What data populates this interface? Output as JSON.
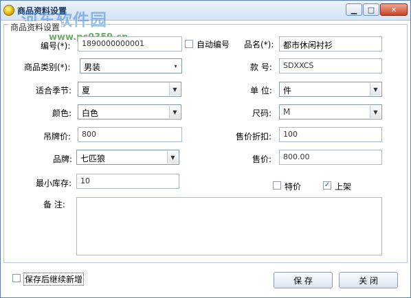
{
  "window": {
    "title": "商品资料设置",
    "watermark": "河东软件园",
    "watermark_url": "www.pc0359.cn",
    "controls": [
      "minimize-icon",
      "maximize-icon",
      "close-icon"
    ]
  },
  "group_title": "商品资料设置",
  "form": {
    "code_label": "编号(*):",
    "code_value": "1890000000001",
    "auto_code_label": "自动编号",
    "auto_code_checked": false,
    "name_label": "品名(*):",
    "name_value": "都市休闲衬衫",
    "category_label": "商品类别(*):",
    "category_value": "男装",
    "style_label": "款 号:",
    "style_value": "SDXXCS",
    "season_label": "适合季节:",
    "season_value": "夏",
    "unit_label": "单 位:",
    "unit_value": "件",
    "color_label": "颜色:",
    "color_value": "白色",
    "size_label": "尺码:",
    "size_value": "M",
    "tag_price_label": "吊牌价:",
    "tag_price_value": "800",
    "discount_label": "售价折扣:",
    "discount_value": "100",
    "brand_label": "品牌:",
    "brand_value": "七匹狼",
    "price_label": "售价:",
    "price_value": "800.00",
    "min_stock_label": "最小库存:",
    "min_stock_value": "10",
    "special_label": "特价",
    "special_checked": false,
    "on_shelf_label": "上架",
    "on_shelf_checked": true,
    "notes_label": "备 注:",
    "notes_value": ""
  },
  "footer": {
    "continue_label": "保存后继续新增",
    "continue_checked": false,
    "save_label": "保 存",
    "close_label": "关 闭"
  }
}
